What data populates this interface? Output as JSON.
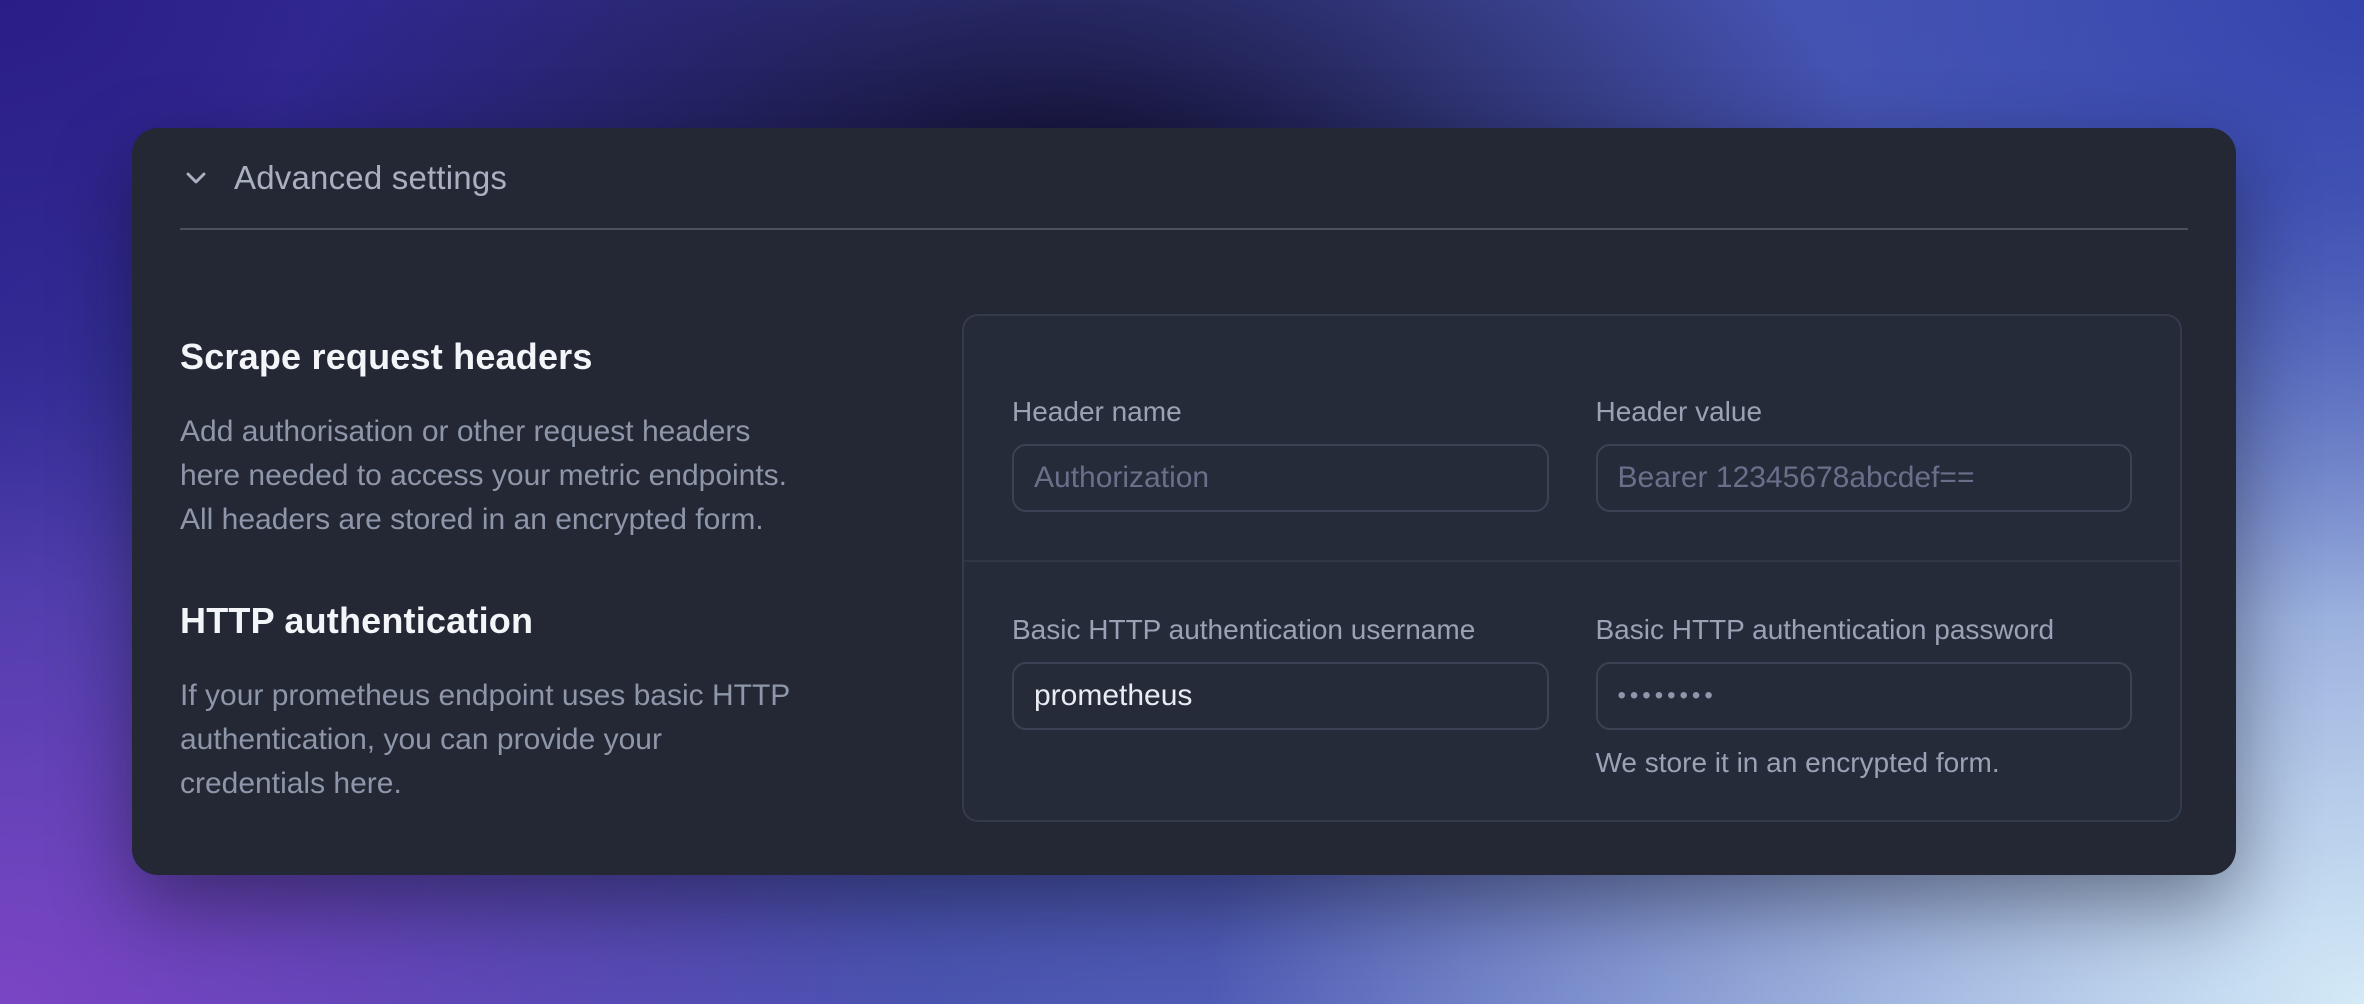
{
  "accordion": {
    "title": "Advanced settings",
    "state": "expanded"
  },
  "sections": {
    "scrape_headers": {
      "heading": "Scrape request headers",
      "description": "Add authorisation or other request headers here needed to access your metric endpoints. All headers are stored in an encrypted form."
    },
    "http_auth": {
      "heading": "HTTP authentication",
      "description": "If your prometheus endpoint uses basic HTTP authentication, you can provide your credentials here."
    }
  },
  "form": {
    "header_name": {
      "label": "Header name",
      "placeholder": "Authorization",
      "value": ""
    },
    "header_value": {
      "label": "Header value",
      "placeholder": "Bearer 12345678abcdef==",
      "value": ""
    },
    "username": {
      "label": "Basic HTTP authentication username",
      "value": "prometheus"
    },
    "password": {
      "label": "Basic HTTP authentication password",
      "masked_value": "••••••••",
      "helper": "We store it in an encrypted form."
    }
  },
  "icons": {
    "accordion_toggle": "chevron-down-icon"
  },
  "colors": {
    "bg_top_left": "#2b1d87",
    "bg_top_center": "#0b0723",
    "bg_top_right": "#3544ad",
    "bg_bottom_left": "#7b45c4",
    "bg_bottom_right": "#d4eaf7",
    "card_bg": "#232834",
    "card_header_text": "#a9b0c2",
    "divider": "#4b515f",
    "panel_bg": "#262b3a",
    "panel_border": "#343b4b",
    "panel_divider": "#303646",
    "heading_text": "#f3f5f9",
    "body_text": "#8e96a9",
    "label_text": "#9aa2b5",
    "input_border": "#3b4253",
    "input_text": "#e9ecf2",
    "placeholder_text": "#69708a",
    "masked_text": "#8f97ab"
  }
}
